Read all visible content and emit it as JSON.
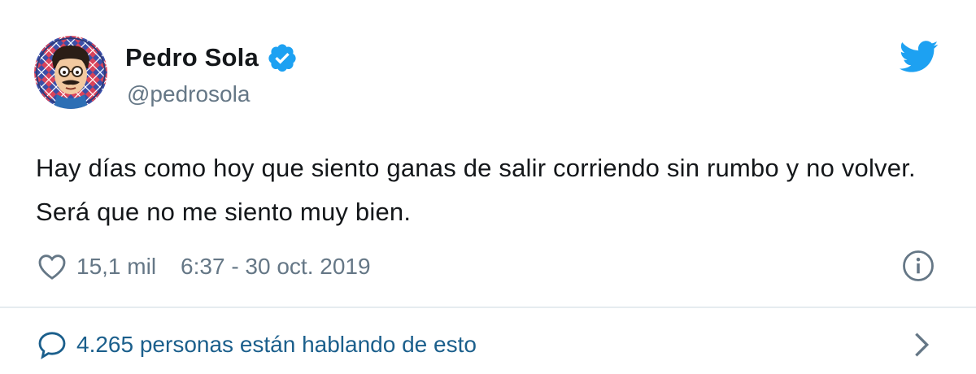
{
  "tweet": {
    "author_name": "Pedro Sola",
    "handle": "@pedrosola",
    "text": "Hay días como hoy que siento ganas de salir corriendo sin rumbo y no volver. Será que no me siento muy bien.",
    "likes": "15,1 mil",
    "timestamp": "6:37 - 30 oct. 2019",
    "conversation": "4.265 personas están hablando de esto"
  },
  "icons": {
    "avatar": "avatar-icon",
    "verified": "verified-badge-icon",
    "logo": "twitter-bird-icon",
    "like": "heart-icon",
    "info": "info-icon",
    "reply": "speech-bubble-icon",
    "more": "chevron-right-icon"
  },
  "colors": {
    "accent": "#1da1f2",
    "text": "#14171a",
    "secondary": "#657786",
    "link": "#1b5f8c",
    "divider": "#e6ecf0"
  }
}
